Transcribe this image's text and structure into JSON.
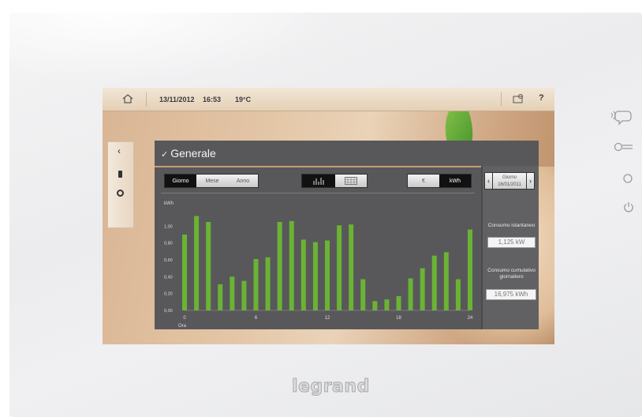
{
  "topbar": {
    "date": "13/11/2012",
    "time": "16:53",
    "temp": "19°C",
    "help": "?"
  },
  "panel": {
    "title": "Generale",
    "period_tabs": [
      {
        "label": "Giorno",
        "active": true
      },
      {
        "label": "Mese",
        "active": false
      },
      {
        "label": "Anno",
        "active": false
      }
    ],
    "view_tabs": [
      {
        "icon": "bar-chart-icon",
        "active": true
      },
      {
        "icon": "table-grid-icon",
        "active": false
      }
    ],
    "unit_tabs": [
      {
        "label": "€",
        "active": false
      },
      {
        "label": "kWh",
        "active": true
      }
    ]
  },
  "day_nav": {
    "label": "Giorno",
    "date": "16/01/2011"
  },
  "info": {
    "instant_label": "Consumo istantaneo",
    "instant_value": "1,125 kW",
    "cumulative_label": "Consumo cumulativo giornaliero",
    "cumulative_value": "16,975 kWh"
  },
  "chart_data": {
    "type": "bar",
    "ylabel": "kWh",
    "xlabel": "Ora",
    "ylim": [
      0,
      1.2
    ],
    "yticks": [
      "0,00",
      "0,20",
      "0,40",
      "0,60",
      "0,80",
      "1,00"
    ],
    "xticks": [
      "0",
      "6",
      "12",
      "18",
      "24"
    ],
    "bar_color": "#6ab334",
    "categories": [
      "0",
      "1",
      "2",
      "3",
      "4",
      "5",
      "6",
      "7",
      "8",
      "9",
      "10",
      "11",
      "12",
      "13",
      "14",
      "15",
      "16",
      "17",
      "18",
      "19",
      "20",
      "21",
      "22",
      "23"
    ],
    "values": [
      0.9,
      1.12,
      1.05,
      0.31,
      0.4,
      0.35,
      0.61,
      0.63,
      1.05,
      1.06,
      0.84,
      0.81,
      0.83,
      1.01,
      1.02,
      0.37,
      0.11,
      0.13,
      0.17,
      0.38,
      0.5,
      0.65,
      0.69,
      0.37,
      0.96
    ]
  },
  "brand": "legrand",
  "colors": {
    "panel_bg": "#58585a",
    "accent_line": "#c49f78",
    "bar": "#6ab334"
  }
}
